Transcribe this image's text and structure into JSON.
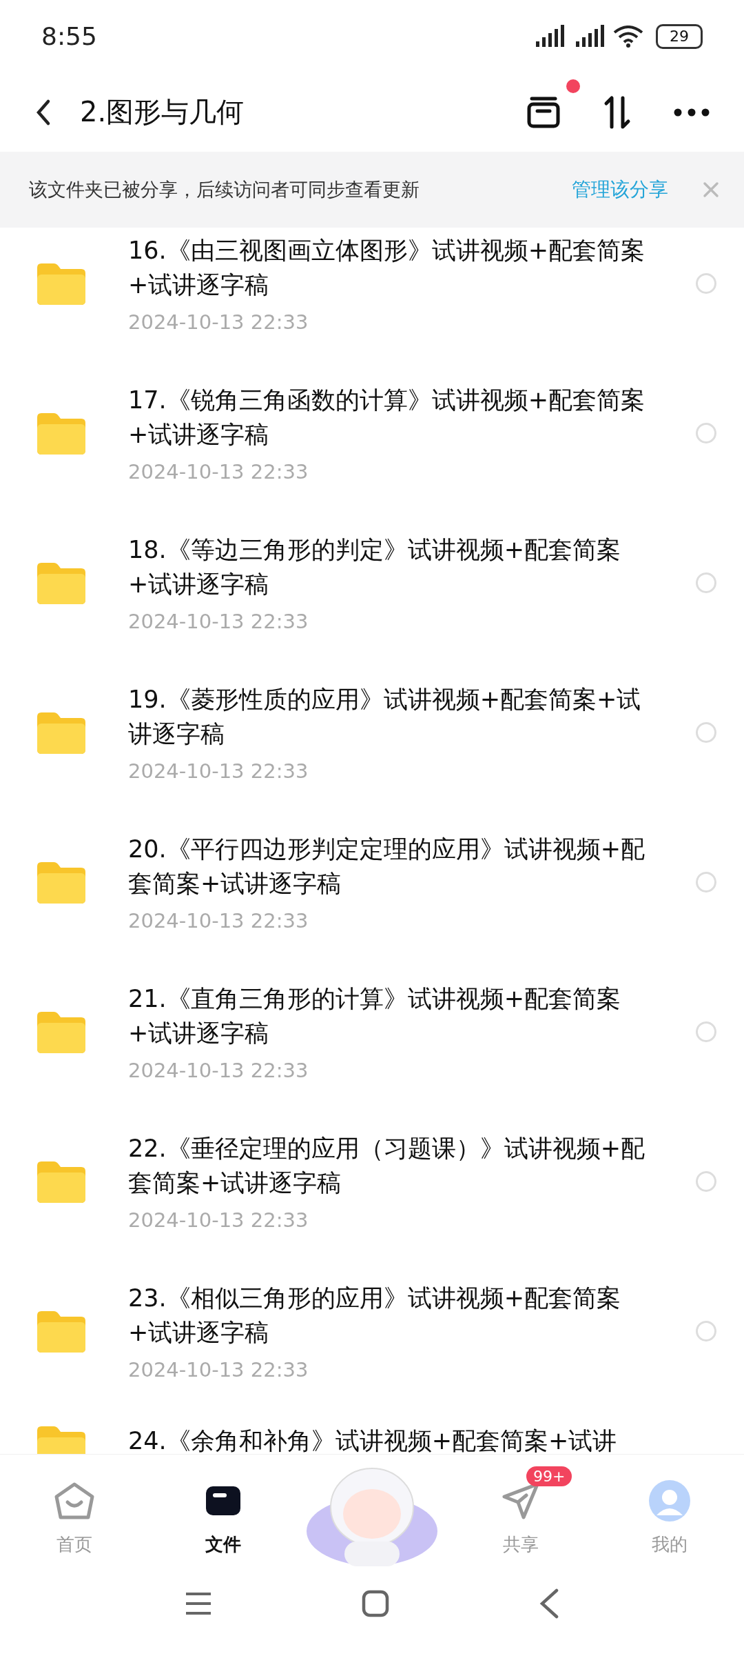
{
  "status_bar": {
    "time": "8:55",
    "battery": "29"
  },
  "header": {
    "title": "2.图形与几何",
    "has_notification": true
  },
  "share_banner": {
    "text": "该文件夹已被分享，后续访问者可同步查看更新",
    "link": "管理该分享"
  },
  "files": [
    {
      "title": "16.《由三视图画立体图形》试讲视频+配套简案+试讲逐字稿",
      "date": "2024-10-13  22:33",
      "selected": false
    },
    {
      "title": "17.《锐角三角函数的计算》试讲视频+配套简案+试讲逐字稿",
      "date": "2024-10-13  22:33",
      "selected": false
    },
    {
      "title": "18.《等边三角形的判定》试讲视频+配套简案+试讲逐字稿",
      "date": "2024-10-13  22:33",
      "selected": false
    },
    {
      "title": "19.《菱形性质的应用》试讲视频+配套简案+试讲逐字稿",
      "date": "2024-10-13  22:33",
      "selected": false
    },
    {
      "title": "20.《平行四边形判定定理的应用》试讲视频+配套简案+试讲逐字稿",
      "date": "2024-10-13  22:33",
      "selected": false
    },
    {
      "title": "21.《直角三角形的计算》试讲视频+配套简案+试讲逐字稿",
      "date": "2024-10-13  22:33",
      "selected": false
    },
    {
      "title": "22.《垂径定理的应用（习题课）》试讲视频+配套简案+试讲逐字稿",
      "date": "2024-10-13  22:33",
      "selected": false
    },
    {
      "title": "23.《相似三角形的应用》试讲视频+配套简案+试讲逐字稿",
      "date": "2024-10-13  22:33",
      "selected": false
    },
    {
      "title": "24.《余角和补角》试讲视频+配套简案+试讲"
    }
  ],
  "bottom_nav": [
    {
      "kind": "home",
      "label": "首页",
      "selected": false
    },
    {
      "kind": "files",
      "label": "文件",
      "selected": true
    },
    {
      "kind": "mascot"
    },
    {
      "kind": "share",
      "label": "共享",
      "selected": false,
      "badge": "99+"
    },
    {
      "kind": "me",
      "label": "我的",
      "selected": false
    }
  ]
}
